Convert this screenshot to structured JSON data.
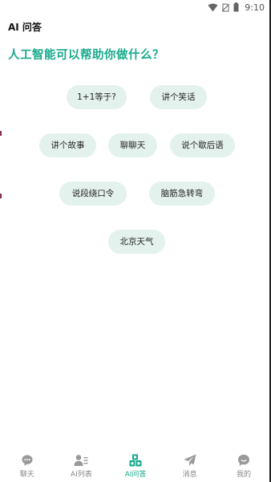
{
  "status_bar": {
    "time": "9:10",
    "icons": [
      "wifi-icon",
      "no-sim-icon",
      "battery-icon"
    ]
  },
  "header": {
    "title": "AI 问答"
  },
  "main": {
    "question": "人工智能可以帮助你做什么？",
    "suggestions": [
      "1+1等于?",
      "讲个笑话",
      "讲个故事",
      "聊聊天",
      "说个歇后语",
      "说段绕口令",
      "脑筋急转弯",
      "北京天气"
    ]
  },
  "tab_bar": {
    "active": "AI问答",
    "tabs": [
      {
        "label": "聊天",
        "icon": "chat-bubble-icon"
      },
      {
        "label": "AI列表",
        "icon": "user-list-icon"
      },
      {
        "label": "AI问答",
        "icon": "ai-blocks-icon"
      },
      {
        "label": "消息",
        "icon": "paper-plane-icon"
      },
      {
        "label": "我的",
        "icon": "profile-bubble-icon"
      }
    ]
  },
  "colors": {
    "accent": "#17a98c",
    "chip_background": "#e4f2ee",
    "inactive_tab": "#888888"
  }
}
